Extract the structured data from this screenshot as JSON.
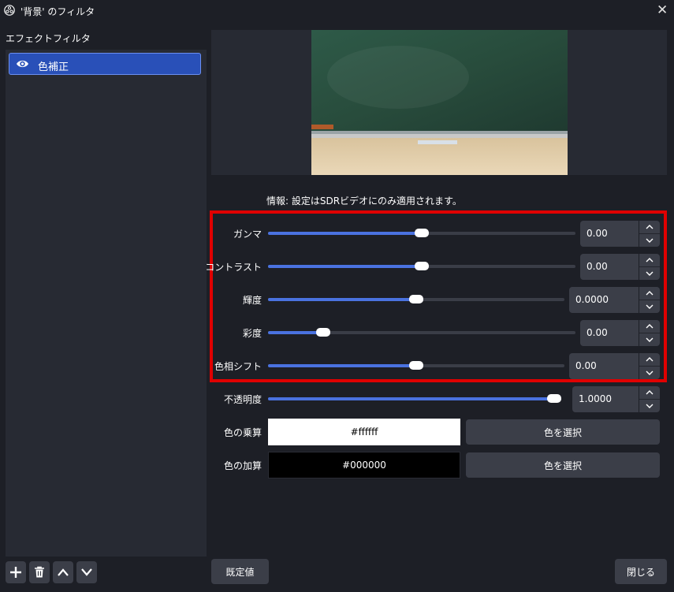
{
  "window": {
    "title": "'背景' のフィルタ",
    "close_glyph": "✕"
  },
  "sidebar": {
    "section_label": "エフェクトフィルタ",
    "filters": [
      {
        "label": "色補正",
        "visible": true,
        "selected": true
      }
    ]
  },
  "info_text": "情報: 設定はSDRビデオにのみ適用されます。",
  "properties": {
    "gamma": {
      "label": "ガンマ",
      "value": "0.00",
      "slider_fraction": 0.5
    },
    "contrast": {
      "label": "コントラスト",
      "value": "0.00",
      "slider_fraction": 0.5
    },
    "brightness": {
      "label": "輝度",
      "value": "0.0000",
      "slider_fraction": 0.5
    },
    "saturation": {
      "label": "彩度",
      "value": "0.00",
      "slider_fraction": 0.18
    },
    "hue_shift": {
      "label": "色相シフト",
      "value": "0.00",
      "slider_fraction": 0.5
    },
    "opacity": {
      "label": "不透明度",
      "value": "1.0000",
      "slider_fraction": 1.0
    }
  },
  "color_multiply": {
    "label": "色の乗算",
    "value": "#ffffff",
    "button": "色を選択",
    "swatch": "#ffffff"
  },
  "color_add": {
    "label": "色の加算",
    "value": "#000000",
    "button": "色を選択",
    "swatch": "#000000"
  },
  "footer": {
    "defaults_button": "既定値",
    "close_button": "閉じる"
  },
  "colors": {
    "accent": "#4a72e0",
    "highlight": "#e00000",
    "selected_item": "#2950b8"
  }
}
